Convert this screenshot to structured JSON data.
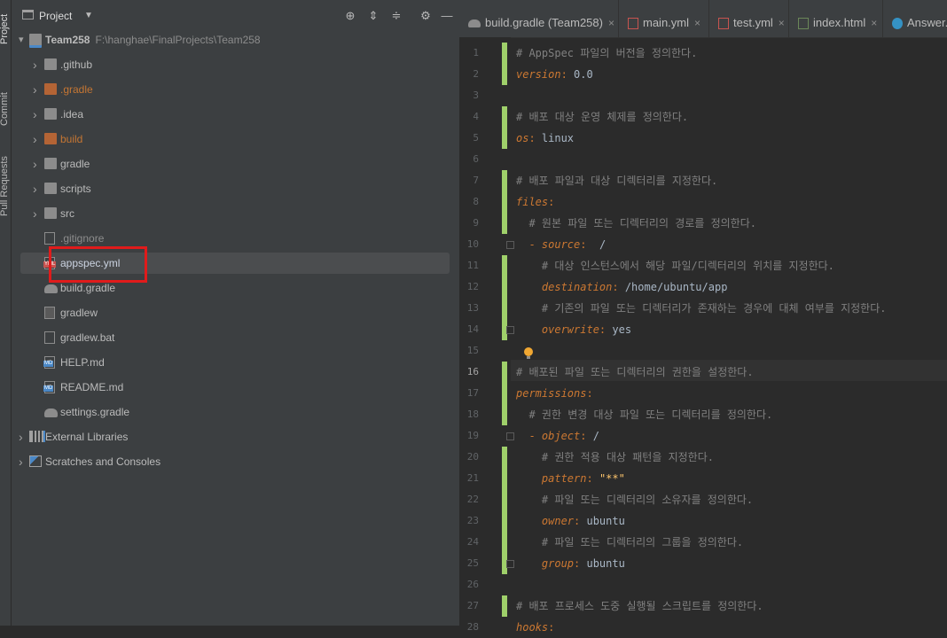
{
  "toolstrip": {
    "tabs": [
      {
        "label": "Project",
        "active": true
      },
      {
        "label": "Commit",
        "active": false
      },
      {
        "label": "Pull Requests",
        "active": false
      }
    ]
  },
  "project_panel": {
    "title": "Project",
    "tree": [
      {
        "label": "Team258",
        "path": "F:\\hanghae\\FinalProjects\\Team258",
        "kind": "module",
        "expanded": true
      },
      {
        "label": ".github",
        "kind": "folder",
        "color": "#8c8c8c"
      },
      {
        "label": ".gradle",
        "kind": "folder",
        "color": "#b46435"
      },
      {
        "label": ".idea",
        "kind": "folder",
        "color": "#8c8c8c"
      },
      {
        "label": "build",
        "kind": "folder",
        "color": "#b46435"
      },
      {
        "label": "gradle",
        "kind": "folder",
        "color": "#8c8c8c"
      },
      {
        "label": "scripts",
        "kind": "folder",
        "color": "#8c8c8c"
      },
      {
        "label": "src",
        "kind": "folder",
        "color": "#8c8c8c"
      },
      {
        "label": ".gitignore",
        "kind": "file"
      },
      {
        "label": "appspec.yml",
        "kind": "yml-file",
        "selected": true
      },
      {
        "label": "build.gradle",
        "kind": "gradle-file"
      },
      {
        "label": "gradlew",
        "kind": "shell-file"
      },
      {
        "label": "gradlew.bat",
        "kind": "file"
      },
      {
        "label": "HELP.md",
        "kind": "md-file"
      },
      {
        "label": "README.md",
        "kind": "md-file"
      },
      {
        "label": "settings.gradle",
        "kind": "gradle-file"
      },
      {
        "label": "External Libraries",
        "kind": "libraries"
      },
      {
        "label": "Scratches and Consoles",
        "kind": "scratches"
      }
    ]
  },
  "editor": {
    "tabs": [
      {
        "label": "build.gradle (Team258)",
        "icon": "gradle-icon"
      },
      {
        "label": "main.yml",
        "icon": "yml-icon"
      },
      {
        "label": "test.yml",
        "icon": "yml-icon"
      },
      {
        "label": "index.html",
        "icon": "html-icon"
      },
      {
        "label": "Answer.j",
        "icon": "class-icon"
      }
    ],
    "current_line": 16,
    "lines": [
      {
        "n": "1",
        "parts": [
          {
            "t": "# AppSpec 파일의 버전을 정의한다.",
            "c": "cm"
          }
        ]
      },
      {
        "n": "2",
        "parts": [
          {
            "t": "version",
            "c": "key"
          },
          {
            "t": ": ",
            "c": "dash"
          },
          {
            "t": "0.0",
            "c": "val"
          }
        ]
      },
      {
        "n": "3",
        "parts": []
      },
      {
        "n": "4",
        "parts": [
          {
            "t": "# 배포 대상 운영 체제를 정의한다.",
            "c": "cm"
          }
        ]
      },
      {
        "n": "5",
        "parts": [
          {
            "t": "os",
            "c": "key"
          },
          {
            "t": ": ",
            "c": "dash"
          },
          {
            "t": "linux",
            "c": "val"
          }
        ]
      },
      {
        "n": "6",
        "parts": []
      },
      {
        "n": "7",
        "parts": [
          {
            "t": "# 배포 파일과 대상 디렉터리를 지정한다.",
            "c": "cm"
          }
        ]
      },
      {
        "n": "8",
        "parts": [
          {
            "t": "files",
            "c": "key"
          },
          {
            "t": ":",
            "c": "dash"
          }
        ]
      },
      {
        "n": "9",
        "parts": [
          {
            "t": "  # 원본 파일 또는 디렉터리의 경로를 정의한다.",
            "c": "cm"
          }
        ]
      },
      {
        "n": "10",
        "parts": [
          {
            "t": "  - ",
            "c": "dash"
          },
          {
            "t": "source",
            "c": "key"
          },
          {
            "t": ":  ",
            "c": "dash"
          },
          {
            "t": "/",
            "c": "val"
          }
        ]
      },
      {
        "n": "11",
        "parts": [
          {
            "t": "    # 대상 인스턴스에서 해당 파일/디렉터리의 위치를 지정한다.",
            "c": "cm"
          }
        ]
      },
      {
        "n": "12",
        "parts": [
          {
            "t": "    destination",
            "c": "key"
          },
          {
            "t": ": ",
            "c": "dash"
          },
          {
            "t": "/home/ubuntu/app",
            "c": "val"
          }
        ]
      },
      {
        "n": "13",
        "parts": [
          {
            "t": "    # 기존의 파일 또는 디렉터리가 존재하는 경우에 대체 여부를 지정한다.",
            "c": "cm"
          }
        ]
      },
      {
        "n": "14",
        "parts": [
          {
            "t": "    overwrite",
            "c": "key"
          },
          {
            "t": ": ",
            "c": "dash"
          },
          {
            "t": "yes",
            "c": "val"
          }
        ]
      },
      {
        "n": "15",
        "parts": []
      },
      {
        "n": "16",
        "parts": [
          {
            "t": "# 배포된 파일 또는 디렉터리의 권한을 설정한다.",
            "c": "cm"
          }
        ]
      },
      {
        "n": "17",
        "parts": [
          {
            "t": "permissions",
            "c": "key"
          },
          {
            "t": ":",
            "c": "dash"
          }
        ]
      },
      {
        "n": "18",
        "parts": [
          {
            "t": "  # 권한 변경 대상 파일 또는 디렉터리를 정의한다.",
            "c": "cm"
          }
        ]
      },
      {
        "n": "19",
        "parts": [
          {
            "t": "  - ",
            "c": "dash"
          },
          {
            "t": "object",
            "c": "key"
          },
          {
            "t": ": ",
            "c": "dash"
          },
          {
            "t": "/",
            "c": "val"
          }
        ]
      },
      {
        "n": "20",
        "parts": [
          {
            "t": "    # 권한 적용 대상 패턴을 지정한다.",
            "c": "cm"
          }
        ]
      },
      {
        "n": "21",
        "parts": [
          {
            "t": "    pattern",
            "c": "key"
          },
          {
            "t": ": ",
            "c": "dash"
          },
          {
            "t": "\"**\"",
            "c": "str"
          }
        ]
      },
      {
        "n": "22",
        "parts": [
          {
            "t": "    # 파일 또는 디렉터리의 소유자를 정의한다.",
            "c": "cm"
          }
        ]
      },
      {
        "n": "23",
        "parts": [
          {
            "t": "    owner",
            "c": "key"
          },
          {
            "t": ": ",
            "c": "dash"
          },
          {
            "t": "ubuntu",
            "c": "val"
          }
        ]
      },
      {
        "n": "24",
        "parts": [
          {
            "t": "    # 파일 또는 디렉터리의 그룹을 정의한다.",
            "c": "cm"
          }
        ]
      },
      {
        "n": "25",
        "parts": [
          {
            "t": "    group",
            "c": "key"
          },
          {
            "t": ": ",
            "c": "dash"
          },
          {
            "t": "ubuntu",
            "c": "val"
          }
        ]
      },
      {
        "n": "26",
        "parts": []
      },
      {
        "n": "27",
        "parts": [
          {
            "t": "# 배포 프로세스 도중 실행될 스크립트를 정의한다.",
            "c": "cm"
          }
        ]
      },
      {
        "n": "28",
        "parts": [
          {
            "t": "hooks",
            "c": "key"
          },
          {
            "t": ":",
            "c": "dash"
          }
        ]
      }
    ],
    "changed_lines": [
      1,
      2,
      4,
      5,
      7,
      8,
      9,
      11,
      12,
      13,
      14,
      16,
      17,
      18,
      20,
      21,
      22,
      23,
      24,
      25,
      27
    ],
    "fold_lines": [
      10,
      14,
      19,
      25
    ]
  }
}
